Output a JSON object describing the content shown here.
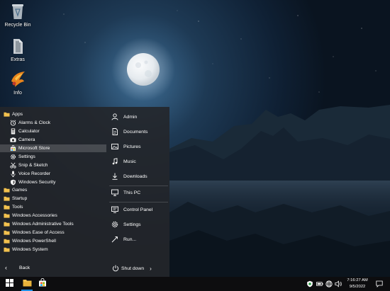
{
  "desktop": {
    "icons": [
      {
        "label": "Recycle Bin",
        "icon": "recycle-bin-icon"
      },
      {
        "label": "Extras",
        "icon": "extras-icon"
      },
      {
        "label": "Info",
        "icon": "info-logo-icon"
      }
    ]
  },
  "start_menu": {
    "apps": [
      {
        "label": "Apps",
        "icon": "folder-icon"
      },
      {
        "label": "Alarms & Clock",
        "icon": "alarm-clock-icon"
      },
      {
        "label": "Calculator",
        "icon": "calculator-icon"
      },
      {
        "label": "Camera",
        "icon": "camera-icon"
      },
      {
        "label": "Microsoft Store",
        "icon": "store-icon",
        "selected": true
      },
      {
        "label": "Settings",
        "icon": "gear-icon"
      },
      {
        "label": "Snip & Sketch",
        "icon": "snip-icon"
      },
      {
        "label": "Voice Recorder",
        "icon": "microphone-icon"
      },
      {
        "label": "Windows Security",
        "icon": "shield-icon"
      },
      {
        "label": "Games",
        "icon": "folder-icon"
      },
      {
        "label": "Startup",
        "icon": "folder-icon"
      },
      {
        "label": "Tools",
        "icon": "folder-icon"
      },
      {
        "label": "Windows Accessories",
        "icon": "folder-icon"
      },
      {
        "label": "Windows Administrative Tools",
        "icon": "folder-icon"
      },
      {
        "label": "Windows Ease of Access",
        "icon": "folder-icon"
      },
      {
        "label": "Windows PowerShell",
        "icon": "folder-icon"
      },
      {
        "label": "Windows System",
        "icon": "folder-icon"
      }
    ],
    "back_label": "Back",
    "places": [
      {
        "label": "Admin",
        "icon": "user-icon"
      },
      {
        "label": "Documents",
        "icon": "documents-icon"
      },
      {
        "label": "Pictures",
        "icon": "pictures-icon"
      },
      {
        "label": "Music",
        "icon": "music-icon"
      },
      {
        "label": "Downloads",
        "icon": "downloads-icon"
      },
      {
        "label": "This PC",
        "icon": "computer-icon"
      },
      {
        "label": "Control Panel",
        "icon": "control-panel-icon"
      },
      {
        "label": "Settings",
        "icon": "gear-icon"
      },
      {
        "label": "Run...",
        "icon": "run-icon"
      }
    ],
    "shutdown_label": "Shut down"
  },
  "taskbar": {
    "time": "7:16:27 AM",
    "date": "9/5/2022",
    "pinned": [
      "start-icon",
      "file-explorer-icon",
      "store-icon"
    ],
    "tray": [
      "security-tray-icon",
      "battery-icon",
      "network-icon",
      "volume-icon"
    ],
    "notification_icon": "notification-icon",
    "accent_color": "#1e90e6"
  }
}
